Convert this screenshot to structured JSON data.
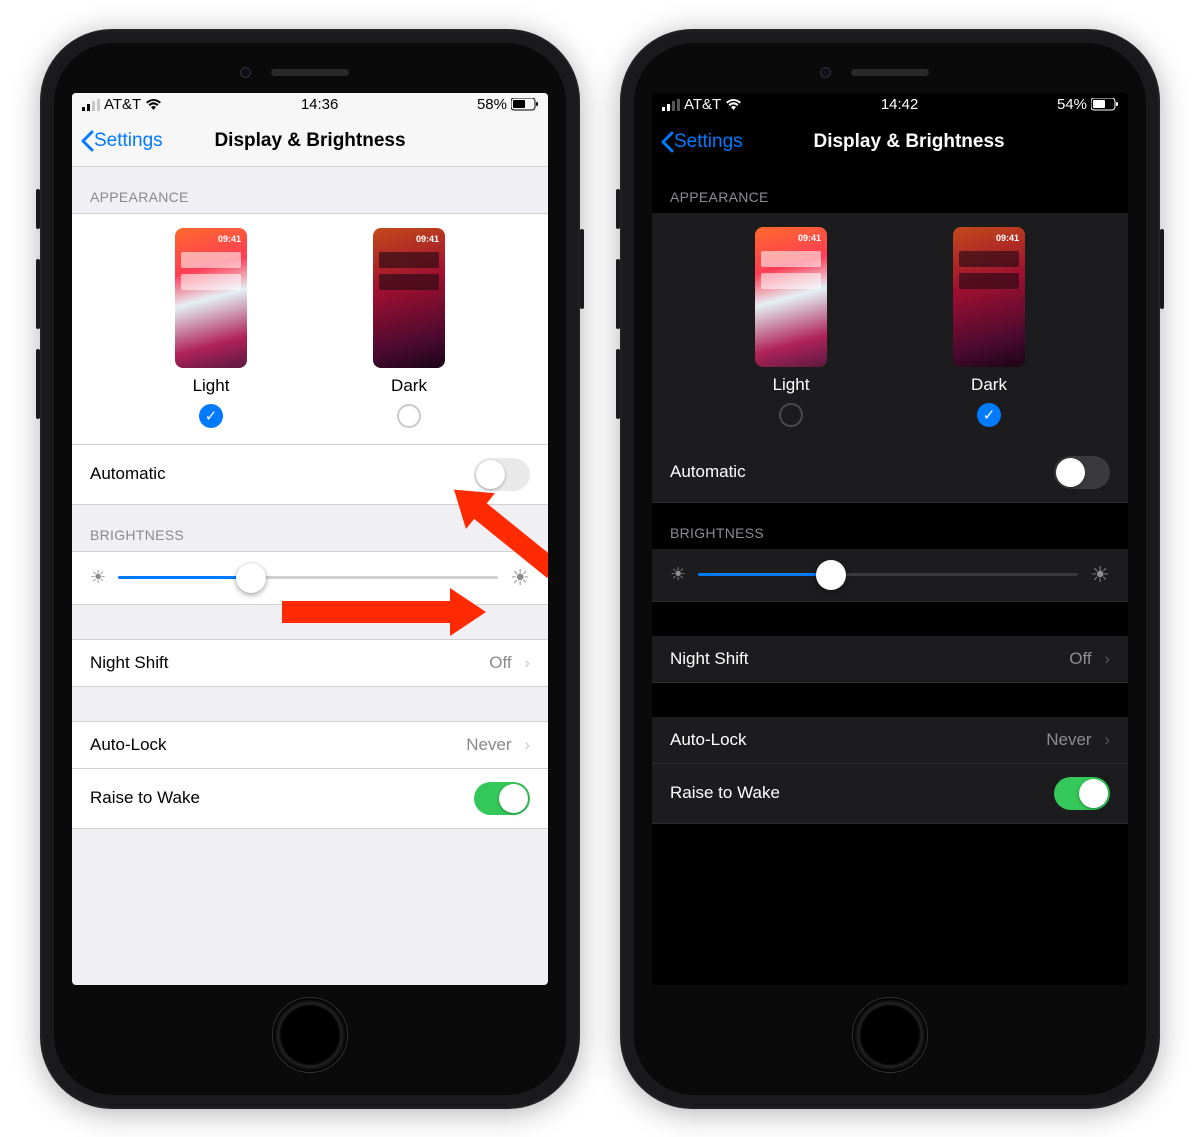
{
  "phones": {
    "light": {
      "status": {
        "carrier": "AT&T",
        "time": "14:36",
        "battery_pct": "58%"
      },
      "nav": {
        "back": "Settings",
        "title": "Display & Brightness"
      },
      "appearance": {
        "header": "APPEARANCE",
        "preview_time": "09:41",
        "light_label": "Light",
        "dark_label": "Dark",
        "selected": "light",
        "automatic_label": "Automatic",
        "automatic_on": false
      },
      "brightness": {
        "header": "BRIGHTNESS",
        "value_pct": 35
      },
      "night_shift": {
        "label": "Night Shift",
        "value": "Off"
      },
      "auto_lock": {
        "label": "Auto-Lock",
        "value": "Never"
      },
      "raise_to_wake": {
        "label": "Raise to Wake",
        "on": true
      }
    },
    "dark": {
      "status": {
        "carrier": "AT&T",
        "time": "14:42",
        "battery_pct": "54%"
      },
      "nav": {
        "back": "Settings",
        "title": "Display & Brightness"
      },
      "appearance": {
        "header": "APPEARANCE",
        "preview_time": "09:41",
        "light_label": "Light",
        "dark_label": "Dark",
        "selected": "dark",
        "automatic_label": "Automatic",
        "automatic_on": false
      },
      "brightness": {
        "header": "BRIGHTNESS",
        "value_pct": 35
      },
      "night_shift": {
        "label": "Night Shift",
        "value": "Off"
      },
      "auto_lock": {
        "label": "Auto-Lock",
        "value": "Never"
      },
      "raise_to_wake": {
        "label": "Raise to Wake",
        "on": true
      }
    }
  },
  "annotations": {
    "arrow_to_dark_radio": true,
    "arrow_to_automatic_toggle": true
  }
}
